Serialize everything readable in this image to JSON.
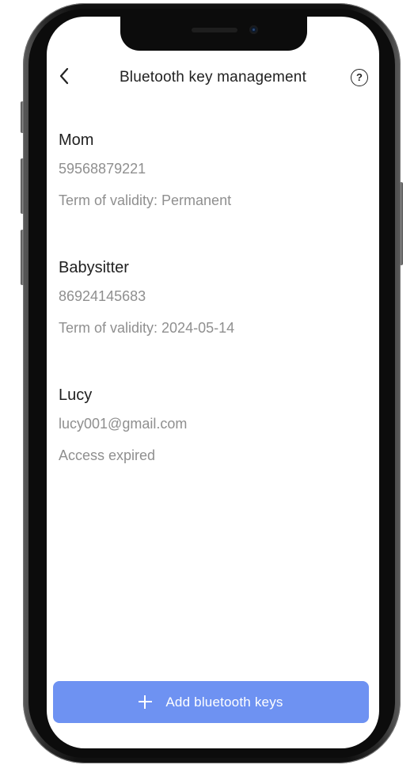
{
  "header": {
    "title": "Bluetooth key management",
    "help_glyph": "?"
  },
  "keys": [
    {
      "name": "Mom",
      "identifier": "59568879221",
      "validity": "Term of validity: Permanent"
    },
    {
      "name": "Babysitter",
      "identifier": "86924145683",
      "validity": "Term of validity: 2024-05-14"
    },
    {
      "name": "Lucy",
      "identifier": "lucy001@gmail.com",
      "validity": "Access expired"
    }
  ],
  "footer": {
    "add_label": "Add bluetooth keys"
  },
  "icons": {
    "back": "chevron-left-icon",
    "help": "question-circle-icon",
    "add": "plus-icon"
  },
  "colors": {
    "accent": "#6e92f2",
    "primary_text": "#1f1f1f",
    "secondary_text": "#8f8f8f"
  }
}
